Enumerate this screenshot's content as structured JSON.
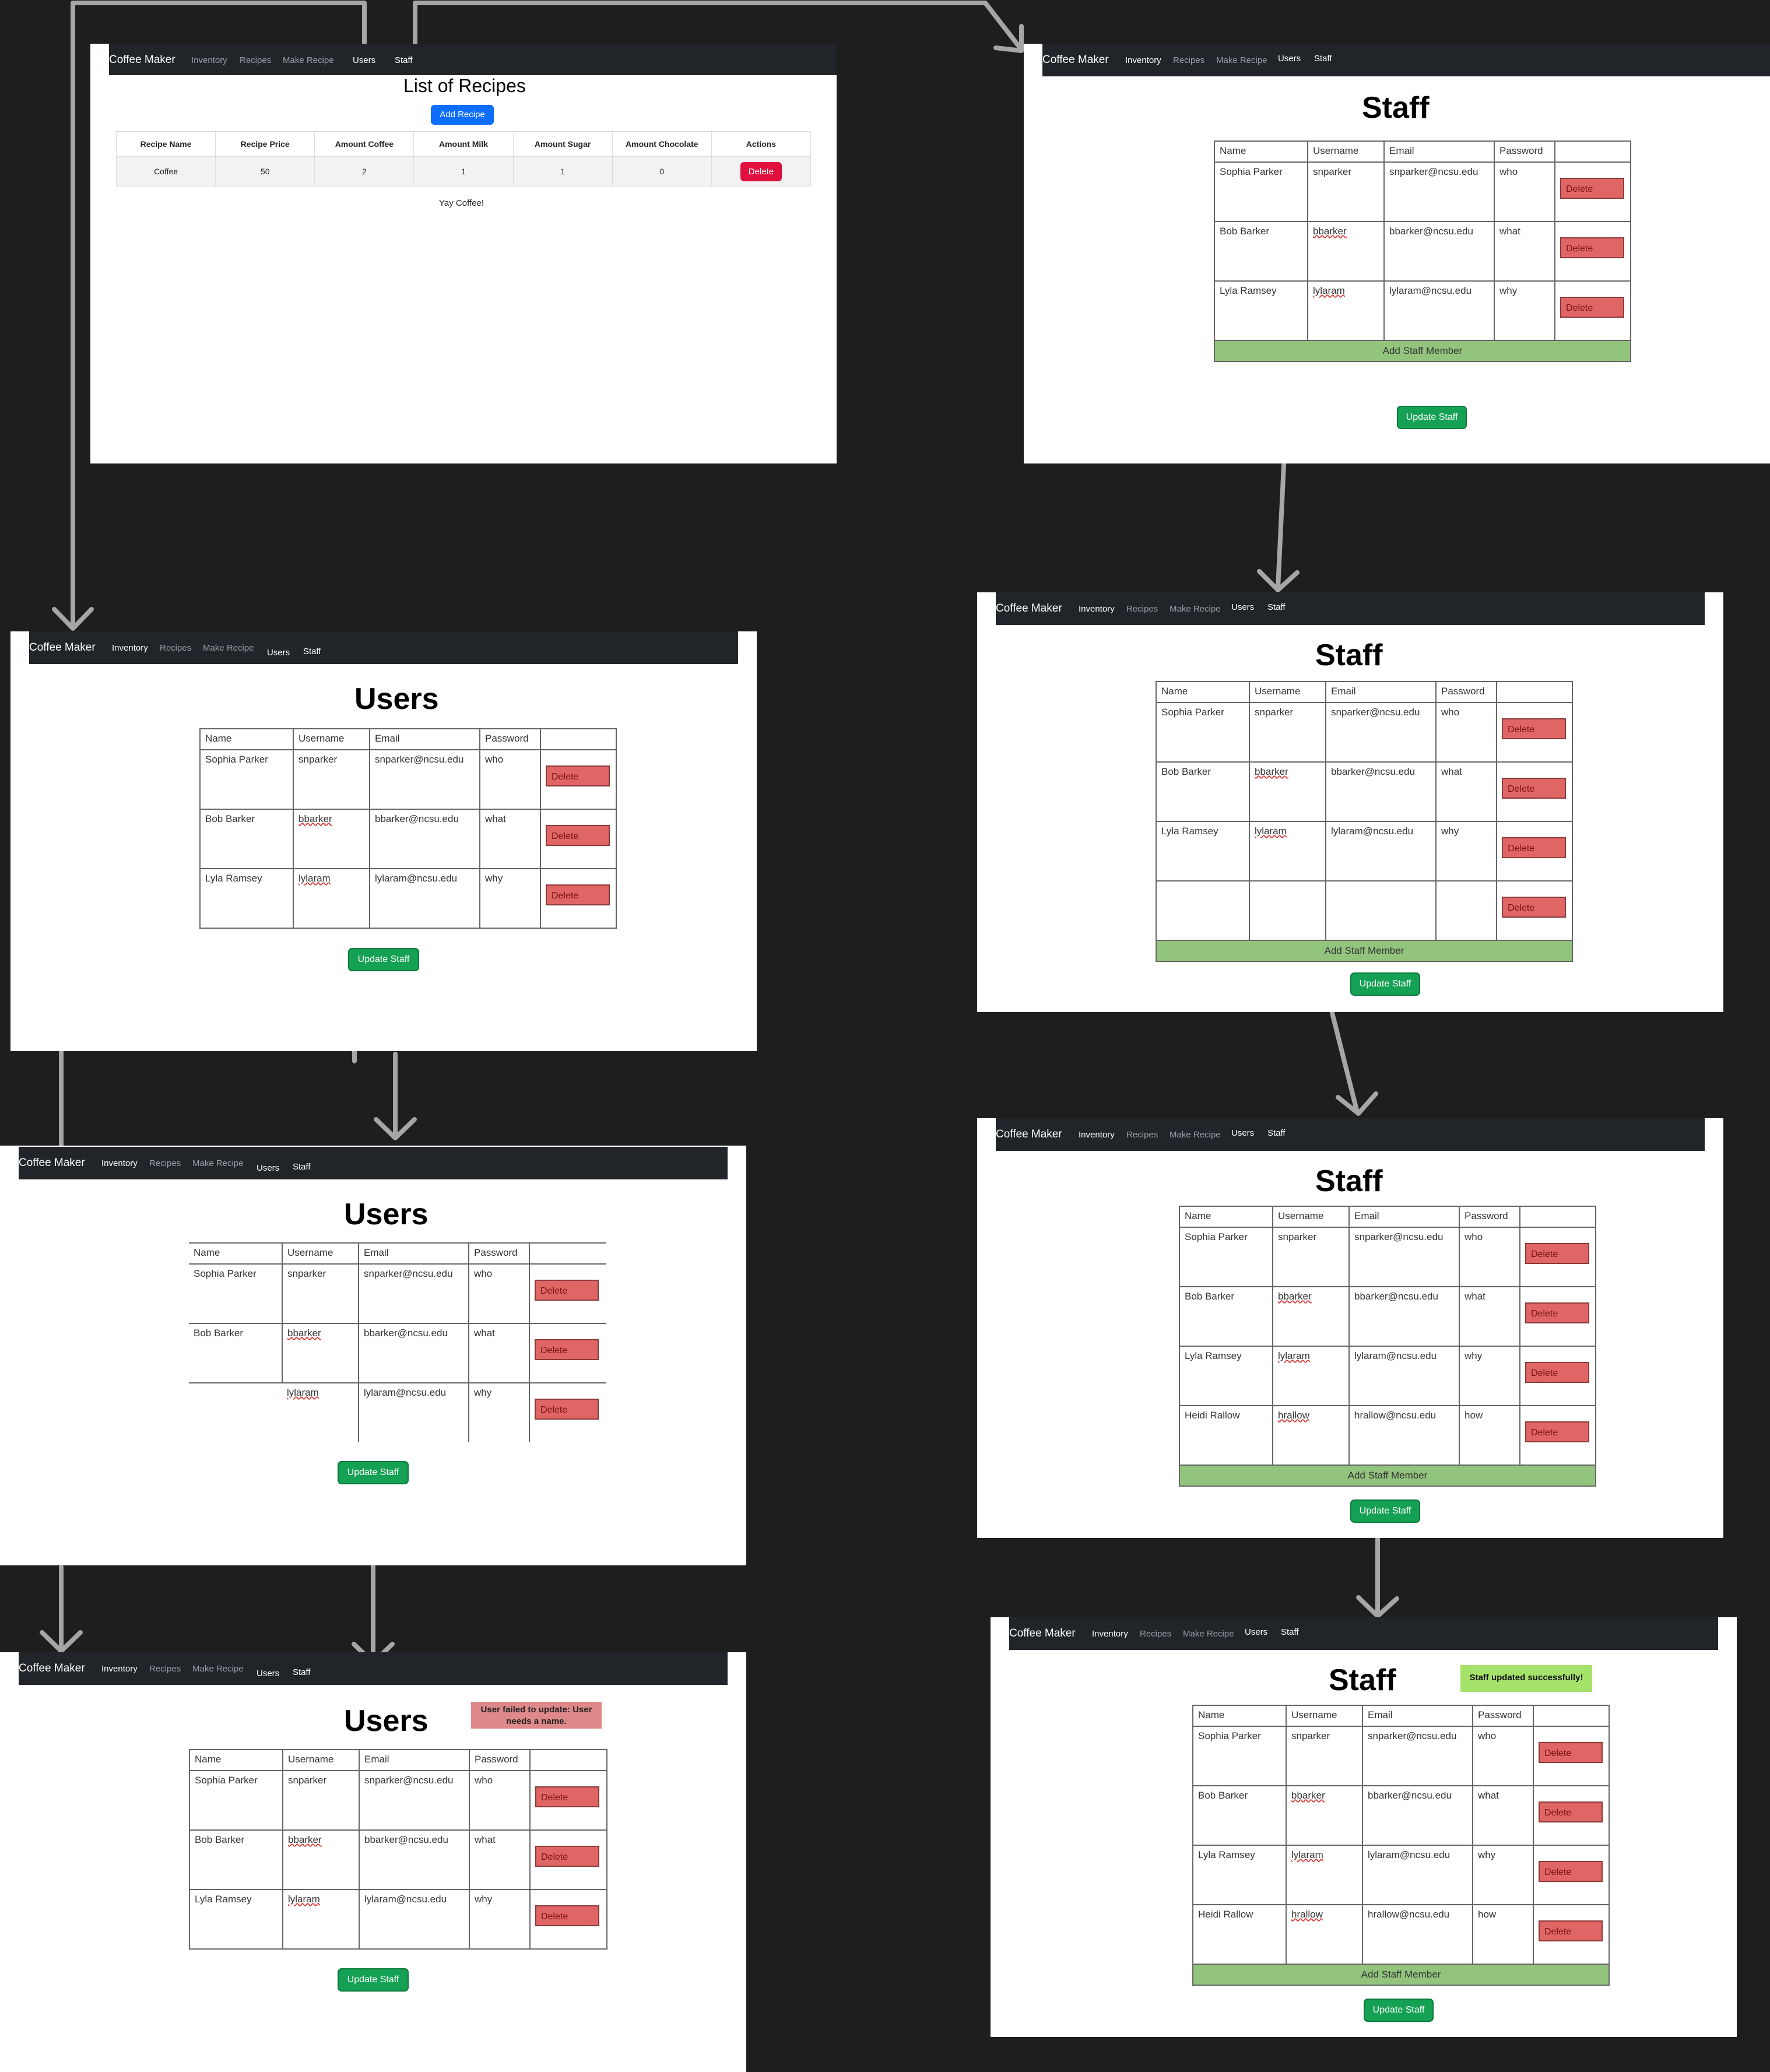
{
  "nav": {
    "brand": "Coffee Maker",
    "links": [
      "Inventory",
      "Recipes",
      "Make Recipe",
      "Users",
      "Staff"
    ]
  },
  "recipes": {
    "title": "List of Recipes",
    "add_button": "Add Recipe",
    "headers": [
      "Recipe Name",
      "Recipe Price",
      "Amount Coffee",
      "Amount Milk",
      "Amount Sugar",
      "Amount Chocolate",
      "Actions"
    ],
    "rows": [
      [
        "Coffee",
        "50",
        "2",
        "1",
        "1",
        "0"
      ]
    ],
    "delete_label": "Delete",
    "footer_text": "Yay Coffee!"
  },
  "table": {
    "headers": [
      "Name",
      "Username",
      "Email",
      "Password"
    ],
    "people": [
      {
        "name": "Sophia Parker",
        "username": "snparker",
        "email": "snparker@ncsu.edu",
        "password": "who"
      },
      {
        "name": "Bob Barker",
        "username": "bbarker",
        "email": "bbarker@ncsu.edu",
        "password": "what"
      },
      {
        "name": "Lyla Ramsey",
        "username": "lylaram",
        "email": "lylaram@ncsu.edu",
        "password": "why"
      },
      {
        "name": "Heidi Rallow",
        "username": "hrallow",
        "email": "hrallow@ncsu.edu",
        "password": "how"
      }
    ],
    "delete_label": "Delete",
    "add_staff_label": "Add Staff Member",
    "update_label": "Update Staff"
  },
  "titles": {
    "staff": "Staff",
    "users": "Users"
  },
  "toasts": {
    "staff_success": "Staff updated successfully!",
    "user_error": "User failed to update: User needs a name."
  },
  "colors": {
    "background": "#1e1e1e",
    "navbar": "#212529",
    "delete": "#e06666",
    "add_staff_row": "#93c47d",
    "update_button": "#15a154",
    "success_toast": "#a5e26a",
    "error_toast": "#e0898a",
    "arrow": "#a6a6a6"
  }
}
